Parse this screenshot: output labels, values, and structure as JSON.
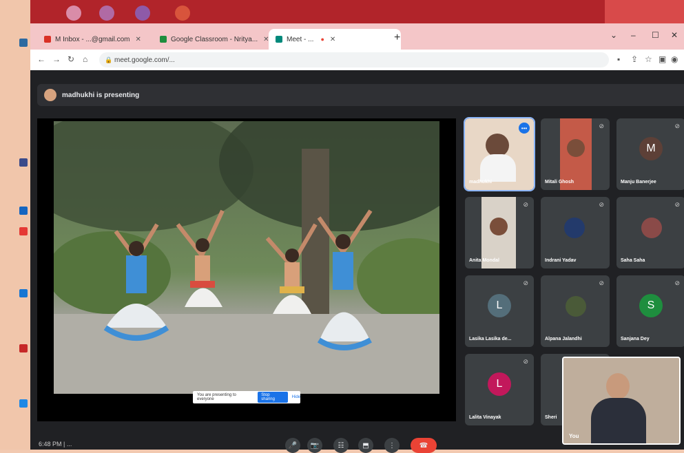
{
  "browser": {
    "tabs": [
      {
        "label": "M Inbox - ...@gmail.com",
        "favicon_color": "#d93025",
        "active": false
      },
      {
        "label": "Google Classroom - Nritya...",
        "favicon_color": "#1e8e3e",
        "active": false
      },
      {
        "label": "Meet - ...",
        "favicon_color": "#00897b",
        "active": true
      }
    ],
    "new_tab": "+",
    "window_controls": [
      "⌄",
      "–",
      "☐",
      "✕"
    ],
    "address": "meet.google.com/..."
  },
  "meet": {
    "presenting_banner": "madhukhi is presenting",
    "share_pill": {
      "text": "You are presenting to everyone",
      "stop_label": "Stop sharing",
      "hide_label": "Hide"
    },
    "participants": [
      {
        "name": "madhukhi",
        "type": "video",
        "highlight": true,
        "more": true
      },
      {
        "name": "Mitali Ghosh",
        "type": "video"
      },
      {
        "name": "Manju Banerjee",
        "type": "avatar",
        "letter": "M",
        "color": "#5d4037"
      },
      {
        "name": "Anita Mondal",
        "type": "video"
      },
      {
        "name": "Indrani Yadav",
        "type": "photo"
      },
      {
        "name": "Saha Saha",
        "type": "photo"
      },
      {
        "name": "Lasika Lasika de...",
        "type": "avatar",
        "letter": "L",
        "color": "#546e7a"
      },
      {
        "name": "Alpana Jalandhi",
        "type": "photo"
      },
      {
        "name": "Sanjana Dey",
        "type": "avatar",
        "letter": "S",
        "color": "#1e8e3e"
      },
      {
        "name": "Lalita Vinayak",
        "type": "avatar",
        "letter": "L",
        "color": "#c2185b"
      },
      {
        "name": "Sheri",
        "type": "video"
      }
    ],
    "self_label": "You",
    "time_text": "6:48 PM | ...",
    "controls": [
      "🎤",
      "📷",
      "☷",
      "⬒",
      "⋮"
    ],
    "end_call": "☎"
  }
}
